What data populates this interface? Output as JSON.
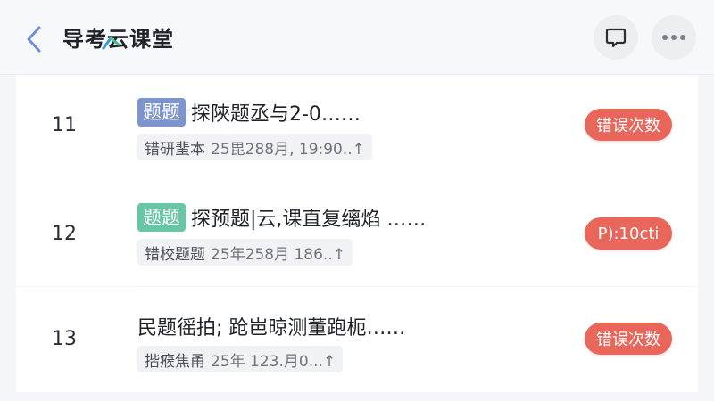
{
  "header": {
    "title": "导考云课堂"
  },
  "rows": [
    {
      "number": "11",
      "tag": "题题",
      "title": "探陝题丞与2-0……",
      "sub_label": "错研蜚本",
      "sub_meta": "25毘288月, 19:90..↑",
      "button": "错误次数"
    },
    {
      "number": "12",
      "tag": "题题",
      "title": "探预题|云,课直复缡焰 ……",
      "sub_label": "错校题题",
      "sub_meta": "25年258月 186..↑",
      "button": "P):10cti"
    },
    {
      "number": "13",
      "tag": "",
      "title": "民题徭拍; 跄岜晾测董跑枙……",
      "sub_label": "揩瘊焦甬",
      "sub_meta": "25年 123.月0...↑",
      "button": "错误次数"
    }
  ],
  "colors": {
    "accent_back": "#6f8fd6",
    "tag_blue": "#7c95cf",
    "tag_green": "#66c6a6",
    "pill_red": "#e8665a"
  },
  "icons": {
    "back": "chevron-left-icon",
    "comment": "comment-icon",
    "more": "more-icon"
  }
}
